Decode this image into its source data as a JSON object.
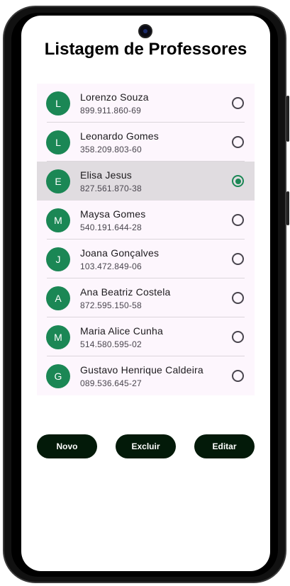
{
  "title": "Listagem de Professores",
  "professors": [
    {
      "initial": "L",
      "name": "Lorenzo Souza",
      "cpf": "899.911.860-69",
      "selected": false
    },
    {
      "initial": "L",
      "name": "Leonardo Gomes",
      "cpf": "358.209.803-60",
      "selected": false
    },
    {
      "initial": "E",
      "name": "Elisa Jesus",
      "cpf": "827.561.870-38",
      "selected": true
    },
    {
      "initial": "M",
      "name": "Maysa Gomes",
      "cpf": "540.191.644-28",
      "selected": false
    },
    {
      "initial": "J",
      "name": "Joana Gonçalves",
      "cpf": "103.472.849-06",
      "selected": false
    },
    {
      "initial": "A",
      "name": "Ana Beatriz Costela",
      "cpf": "872.595.150-58",
      "selected": false
    },
    {
      "initial": "M",
      "name": "Maria Alice Cunha",
      "cpf": "514.580.595-02",
      "selected": false
    },
    {
      "initial": "G",
      "name": "Gustavo Henrique Caldeira",
      "cpf": "089.536.645-27",
      "selected": false
    }
  ],
  "buttons": {
    "new": "Novo",
    "delete": "Excluir",
    "edit": "Editar"
  },
  "colors": {
    "accent": "#1b8755",
    "button": "#031a09"
  }
}
